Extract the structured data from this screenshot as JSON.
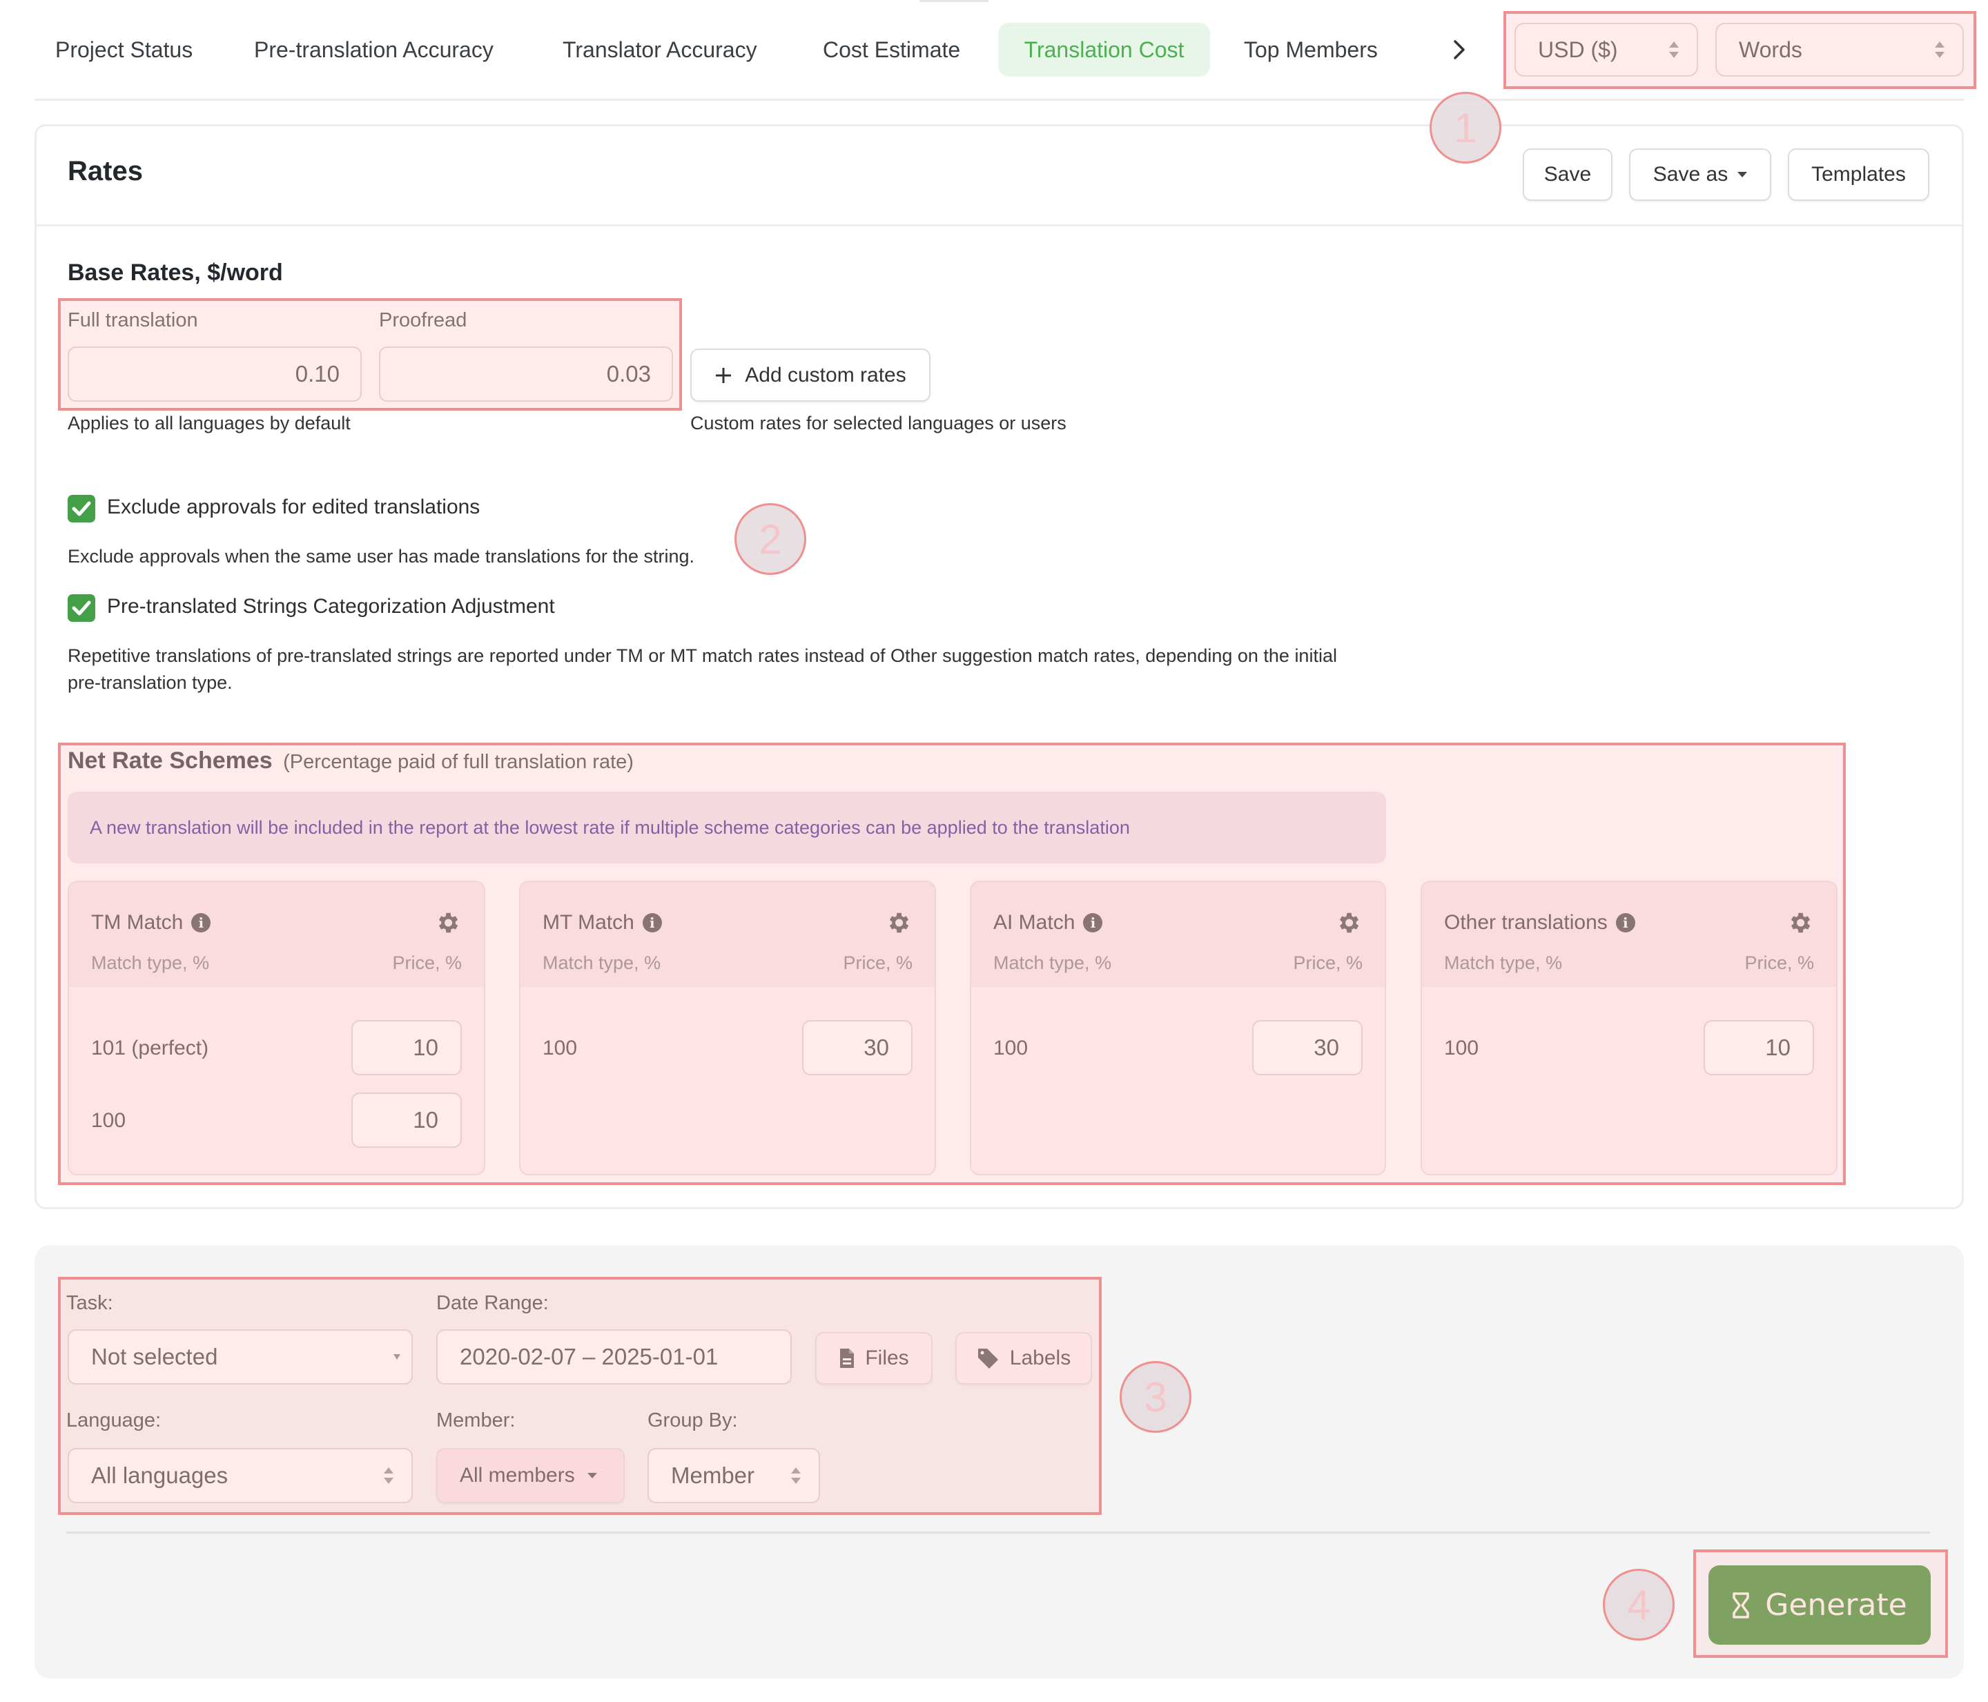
{
  "tabs": {
    "items": [
      {
        "label": "Project Status",
        "active": false
      },
      {
        "label": "Pre-translation Accuracy",
        "active": false
      },
      {
        "label": "Translator Accuracy",
        "active": false
      },
      {
        "label": "Cost Estimate",
        "active": false
      },
      {
        "label": "Translation Cost",
        "active": true
      },
      {
        "label": "Top Members",
        "active": false
      }
    ],
    "more_icon": "chevron-right-icon",
    "currency_select": "USD ($)",
    "unit_select": "Words"
  },
  "annotations": [
    "1",
    "2",
    "3",
    "4"
  ],
  "rates": {
    "title": "Rates",
    "save_label": "Save",
    "save_as_label": "Save as",
    "templates_label": "Templates",
    "base_rates": {
      "title": "Base Rates, $/word",
      "full_translation_label": "Full translation",
      "full_translation_value": "0.10",
      "proofread_label": "Proofread",
      "proofread_value": "0.03",
      "add_custom_rates_label": "Add custom rates",
      "default_helper": "Applies to all languages by default",
      "custom_helper": "Custom rates for selected languages or users"
    },
    "options": [
      {
        "label": "Exclude approvals for edited translations",
        "checked": true,
        "description": "Exclude approvals when the same user has made translations for the string."
      },
      {
        "label": "Pre-translated Strings Categorization Adjustment",
        "checked": true,
        "description_line1": "Repetitive translations of pre-translated strings are reported under TM or MT match rates instead of Other suggestion match rates, depending on the initial",
        "description_line2": "pre-translation type."
      }
    ],
    "net_rate": {
      "title": "Net Rate Schemes",
      "subtitle": "(Percentage paid of full translation rate)",
      "info": "A new translation will be included in the report at the lowest rate if multiple scheme categories can be applied to the translation",
      "col_match": "Match type, %",
      "col_price": "Price, %",
      "schemes": [
        {
          "title": "TM Match",
          "rows": [
            {
              "match": "101 (perfect)",
              "price": "10"
            },
            {
              "match": "100",
              "price": "10"
            }
          ]
        },
        {
          "title": "MT Match",
          "rows": [
            {
              "match": "100",
              "price": "30"
            }
          ]
        },
        {
          "title": "AI Match",
          "rows": [
            {
              "match": "100",
              "price": "30"
            }
          ]
        },
        {
          "title": "Other translations",
          "rows": [
            {
              "match": "100",
              "price": "10"
            }
          ]
        }
      ]
    }
  },
  "filters": {
    "task_label": "Task:",
    "task_value": "Not selected",
    "date_range_label": "Date Range:",
    "date_range_value": "2020-02-07 – 2025-01-01",
    "files_label": "Files",
    "labels_label": "Labels",
    "language_label": "Language:",
    "language_value": "All languages",
    "member_label": "Member:",
    "member_value": "All members",
    "group_by_label": "Group By:",
    "group_by_value": "Member",
    "generate_label": "Generate"
  },
  "colors": {
    "accent_green": "#55963f",
    "active_tab_text": "#4caf50",
    "annotation_red": "#ef8f8f",
    "info_text": "#3b1f8c"
  }
}
